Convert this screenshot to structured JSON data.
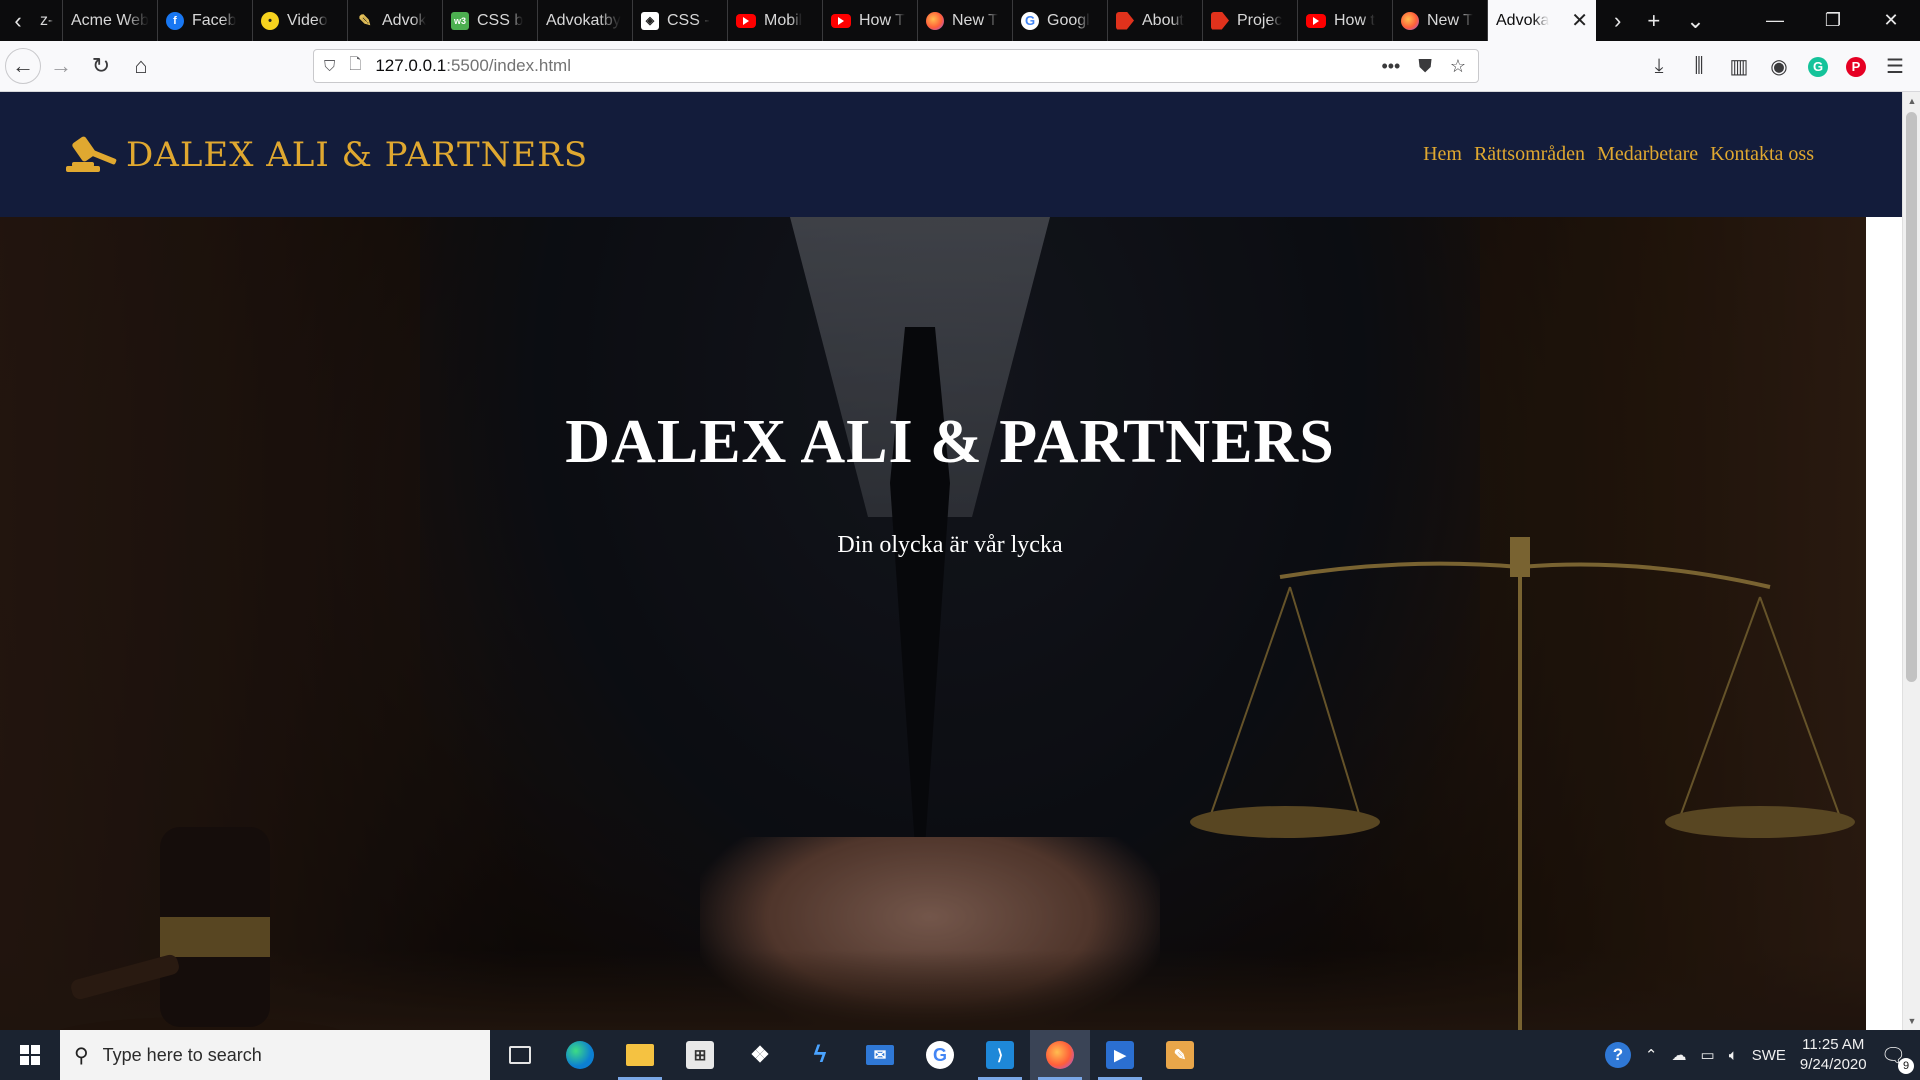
{
  "browser": {
    "tabs": [
      {
        "label": "z-",
        "icon": "generic-tab-icon",
        "active": false
      },
      {
        "label": "Acme Web",
        "icon": "",
        "active": false
      },
      {
        "label": "Faceb",
        "icon": "facebook-icon",
        "active": false
      },
      {
        "label": "Video",
        "icon": "video-icon",
        "active": false
      },
      {
        "label": "Advok",
        "icon": "pen-icon",
        "active": false
      },
      {
        "label": "CSS b",
        "icon": "w3schools-icon",
        "active": false
      },
      {
        "label": "Advokatby",
        "icon": "",
        "active": false
      },
      {
        "label": "CSS - ",
        "icon": "css-icon",
        "active": false
      },
      {
        "label": "Mobil",
        "icon": "youtube-icon",
        "active": false
      },
      {
        "label": "How T",
        "icon": "youtube-icon",
        "active": false
      },
      {
        "label": "New T",
        "icon": "firefox-icon",
        "active": false
      },
      {
        "label": "Googl",
        "icon": "google-icon",
        "active": false
      },
      {
        "label": "About",
        "icon": "brackets-icon",
        "active": false
      },
      {
        "label": "Projec",
        "icon": "brackets-icon",
        "active": false
      },
      {
        "label": "How t",
        "icon": "youtube-icon",
        "active": false
      },
      {
        "label": "New T",
        "icon": "firefox-icon",
        "active": false
      },
      {
        "label": "Advoka",
        "icon": "",
        "active": true
      }
    ],
    "url": {
      "host": "127.0.0.1",
      "path": ":5500/index.html"
    }
  },
  "site": {
    "logo_text": "DALEX ALI & PARTNERS",
    "nav": [
      {
        "label": "Hem"
      },
      {
        "label": "Rättsområden"
      },
      {
        "label": "Medarbetare"
      },
      {
        "label": "Kontakta oss"
      }
    ],
    "hero": {
      "title": "DALEX ALI & PARTNERS",
      "tagline": "Din olycka är vår lycka"
    },
    "colors": {
      "header_bg": "#131c3b",
      "accent_gold": "#e0a830",
      "hero_text": "#ffffff"
    }
  },
  "taskbar": {
    "search_placeholder": "Type here to search",
    "apps": [
      "task-view-icon",
      "edge-icon",
      "file-explorer-icon",
      "store-icon",
      "dropbox-icon",
      "lightning-icon",
      "mail-icon",
      "chrome-icon",
      "vscode-icon",
      "firefox-icon",
      "video-editor-icon",
      "paint-icon"
    ],
    "tray": {
      "language": "SWE",
      "time": "11:25 AM",
      "date": "9/24/2020",
      "notification_count": "9"
    }
  }
}
